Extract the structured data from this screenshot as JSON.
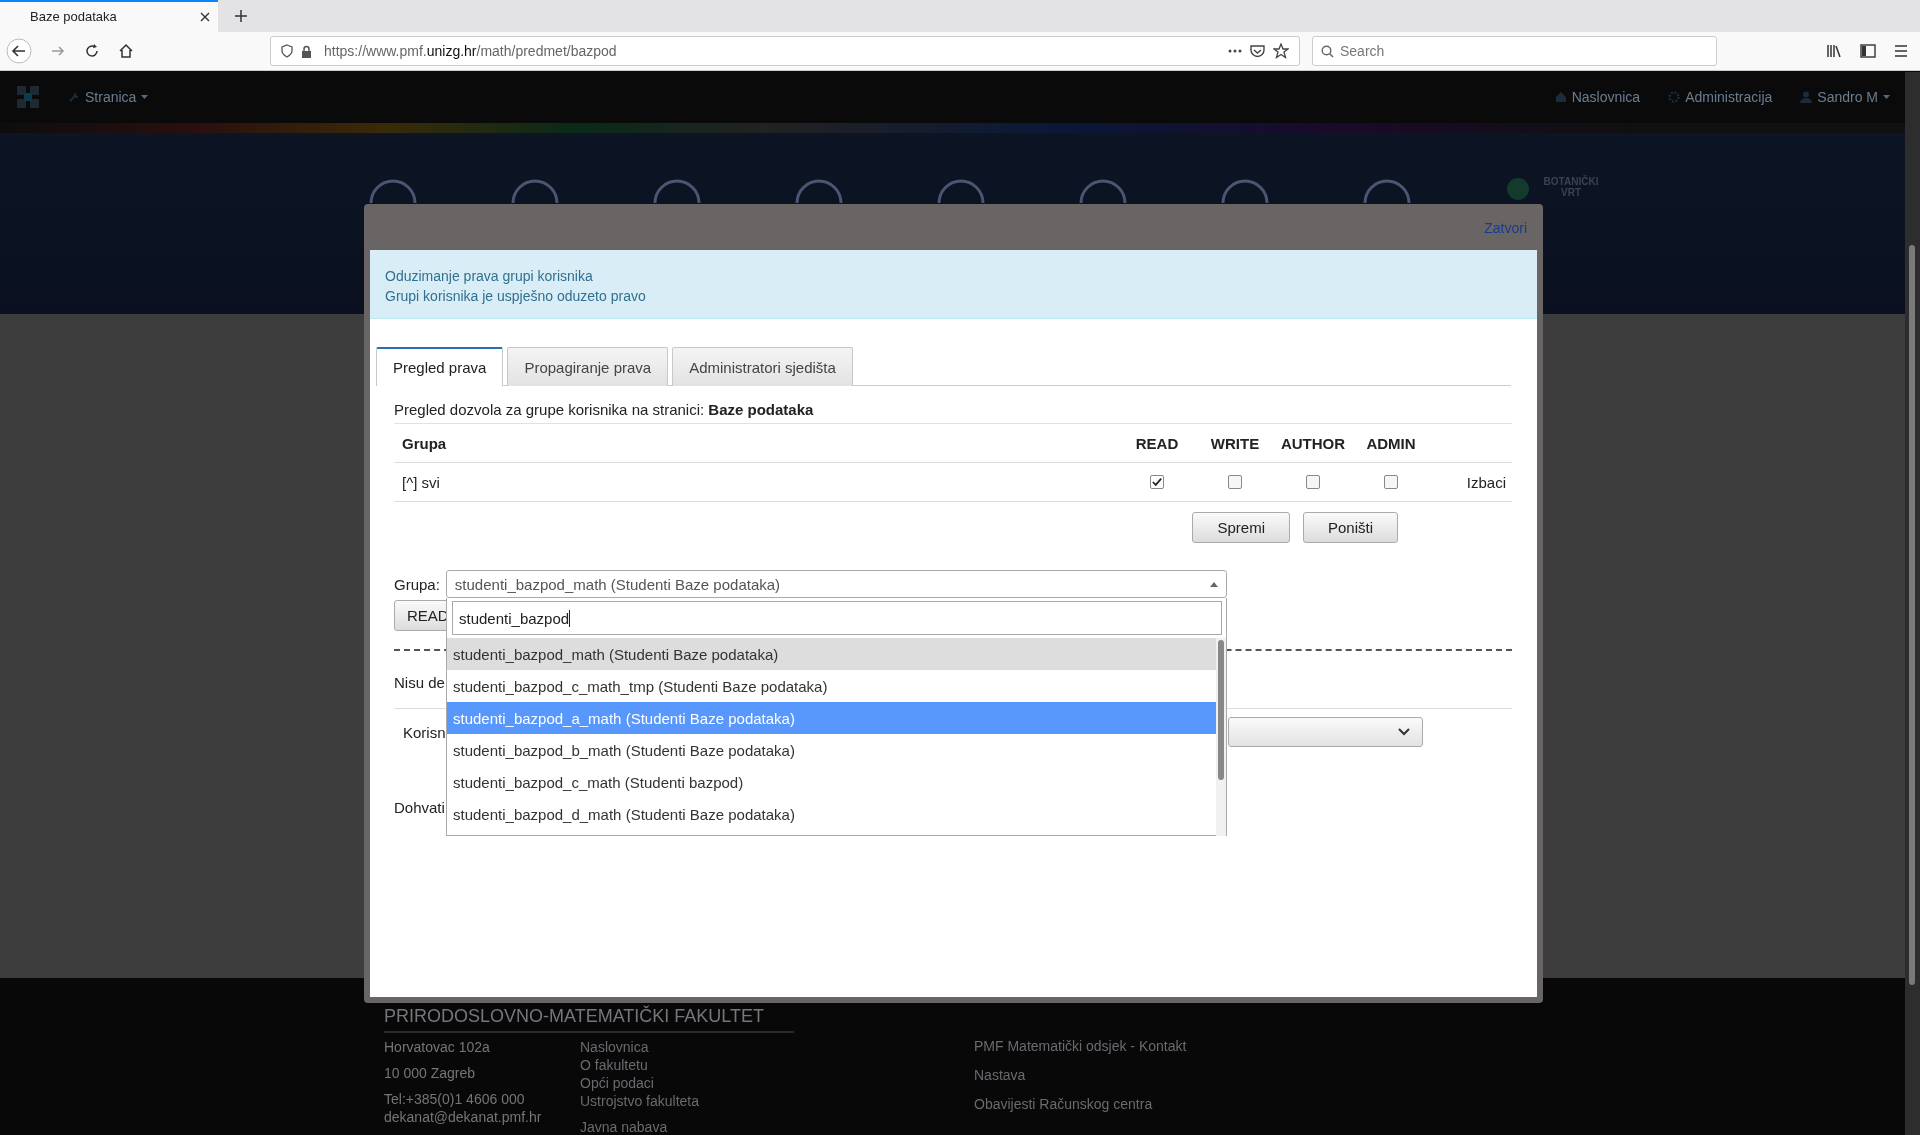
{
  "browser": {
    "tab_title": "Baze podataka",
    "url_prefix": "https://www.pmf.",
    "url_domain": "unizg.hr",
    "url_path": "/math/predmet/bazpod",
    "search_placeholder": "Search"
  },
  "site_nav": {
    "menu": "Stranica",
    "links": [
      "Naslovnica",
      "Administracija",
      "Sandro M"
    ]
  },
  "hero": {
    "badge": "BOTANIČKI VRT"
  },
  "modal": {
    "close": "Zatvori",
    "alert": {
      "title": "Oduzimanje prava grupi korisnika",
      "message": "Grupi korisnika je uspješno oduzeto pravo"
    },
    "tabs": [
      {
        "label": "Pregled prava",
        "selected": true
      },
      {
        "label": "Propagiranje prava",
        "selected": false
      },
      {
        "label": "Administratori sjedišta",
        "selected": false
      }
    ],
    "intro": "Pregled dozvola za grupe korisnika na stranici: **Baze podataka**",
    "table": {
      "columns": [
        "Grupa",
        "READ",
        "WRITE",
        "AUTHOR",
        "ADMIN"
      ],
      "rows": [
        {
          "group": "[^] svi",
          "permissions": [
            {
              "checked": true
            },
            {
              "checked": false
            },
            {
              "checked": false
            },
            {
              "checked": false
            }
          ],
          "action": "Izbaci"
        }
      ]
    },
    "buttons": [
      "Spremi",
      "Poništi"
    ],
    "group_label": "Grupa:",
    "group_select": {
      "value": "studenti_bazpod_math (Studenti Baze podataka)",
      "search": "studenti_bazpod",
      "options": [
        {
          "label": "studenti_bazpod_math (Studenti Baze podataka)",
          "selected": true,
          "hovered": false
        },
        {
          "label": "studenti_bazpod_c_math_tmp (Studenti Baze podataka)",
          "selected": false,
          "hovered": false
        },
        {
          "label": "studenti_bazpod_a_math (Studenti Baze podataka)",
          "selected": false,
          "hovered": true
        },
        {
          "label": "studenti_bazpod_b_math (Studenti Baze podataka)",
          "selected": false,
          "hovered": false
        },
        {
          "label": "studenti_bazpod_c_math (Studenti bazpod)",
          "selected": false,
          "hovered": false
        },
        {
          "label": "studenti_bazpod_d_math (Studenti Baze podataka)",
          "selected": false,
          "hovered": false
        }
      ]
    },
    "covered": {
      "button": "READ",
      "notice": "Nisu de",
      "user_label": "Korisn",
      "fetch_label": "Dohvati"
    }
  },
  "footer": {
    "title": "PRIRODOSLOVNO-MATEMATIČKI FAKULTET",
    "address": [
      "Horvatovac 102a",
      "10 000 Zagreb",
      "Tel:+385(0)1 4606 000",
      "dekanat@dekanat.pmf.hr"
    ],
    "links": [
      "Naslovnica",
      "O fakultetu",
      "Opći podaci",
      "Ustrojstvo fakulteta",
      "Javna nabava"
    ],
    "right_links": [
      "PMF Matematički odsjek - Kontakt",
      "Nastava",
      "Obavijesti Računskog centra"
    ]
  }
}
